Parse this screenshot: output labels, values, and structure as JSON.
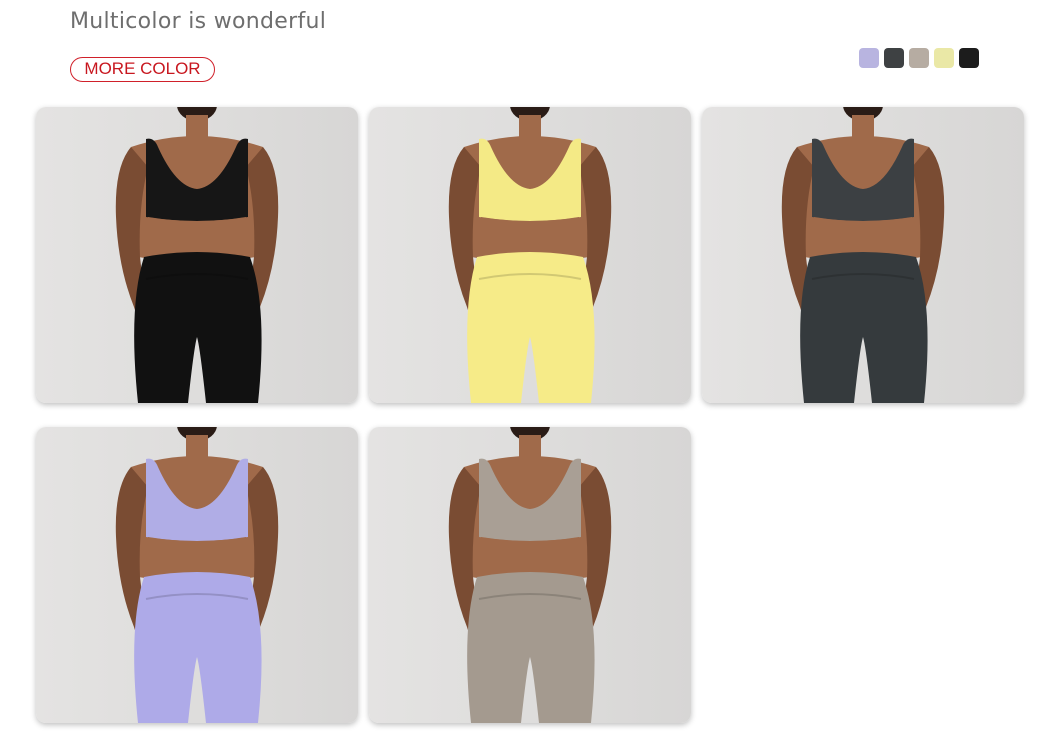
{
  "header": {
    "title": "Multicolor is wonderful",
    "more_button": "MORE COLOR"
  },
  "swatches": [
    {
      "name": "lavender",
      "color": "#b8b4e0"
    },
    {
      "name": "charcoal",
      "color": "#3e4143"
    },
    {
      "name": "taupe",
      "color": "#b6aca2"
    },
    {
      "name": "butter-yellow",
      "color": "#eae8a6"
    },
    {
      "name": "black",
      "color": "#1c1c1c"
    }
  ],
  "products": [
    {
      "name": "black",
      "top": "#161616",
      "bottom": "#111111"
    },
    {
      "name": "yellow",
      "top": "#f4ea86",
      "bottom": "#f6eb88"
    },
    {
      "name": "charcoal",
      "top": "#3c4043",
      "bottom": "#353a3d"
    },
    {
      "name": "lavender",
      "top": "#b0ade6",
      "bottom": "#aeaae8"
    },
    {
      "name": "taupe",
      "top": "#a99f95",
      "bottom": "#a49a8f"
    }
  ]
}
